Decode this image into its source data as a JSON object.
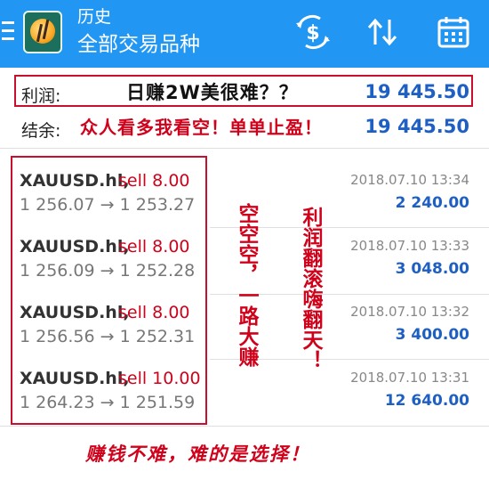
{
  "header": {
    "title": "历史",
    "subtitle": "全部交易品种",
    "icons": [
      "menu-icon",
      "app-logo",
      "currency-exchange-icon",
      "sort-icon",
      "calendar-icon"
    ],
    "bar_color": "#2196f3"
  },
  "summary": {
    "profit_label": "利润:",
    "profit_value": "19 445.50",
    "balance_label": "结余:",
    "balance_value": "19 445.50"
  },
  "annotations": {
    "profit_note": "日赚2W美很难？？",
    "balance_note": "众人看多我看空！单单止盈！",
    "vertical_left": "空空空，一路大赚",
    "vertical_right": "利润翻滚嗨翻天！",
    "bottom": "赚钱不难，难的是选择！",
    "accent_color": "#d0021b"
  },
  "trades": [
    {
      "symbol": "XAUUSD.hl,",
      "side": "sell 8.00",
      "prices": "1 256.07 → 1 253.27",
      "time": "2018.07.10 13:34",
      "profit": "2 240.00"
    },
    {
      "symbol": "XAUUSD.hl,",
      "side": "sell 8.00",
      "prices": "1 256.09 → 1 252.28",
      "time": "2018.07.10 13:33",
      "profit": "3 048.00"
    },
    {
      "symbol": "XAUUSD.hl,",
      "side": "sell 8.00",
      "prices": "1 256.56 → 1 252.31",
      "time": "2018.07.10 13:32",
      "profit": "3 400.00"
    },
    {
      "symbol": "XAUUSD.hl,",
      "side": "sell 10.00",
      "prices": "1 264.23 → 1 251.59",
      "time": "2018.07.10 13:31",
      "profit": "12 640.00"
    }
  ]
}
